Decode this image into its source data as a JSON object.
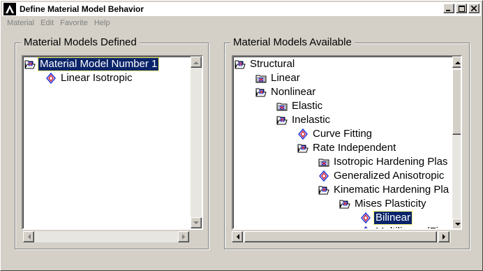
{
  "window": {
    "title": "Define Material Model Behavior"
  },
  "menu": [
    {
      "label": "Material"
    },
    {
      "label": "Edit"
    },
    {
      "label": "Favorite"
    },
    {
      "label": "Help"
    }
  ],
  "defined_panel": {
    "title": "Material Models Defined",
    "items": [
      {
        "label": "Material Model Number 1",
        "icon": "open-folder-icon",
        "selected": true
      },
      {
        "label": "Linear Isotropic",
        "icon": "diamond-leaf-icon",
        "selected": false
      }
    ]
  },
  "available_panel": {
    "title": "Material Models Available",
    "items": [
      {
        "label": "Structural",
        "icon": "open-folder-icon",
        "selected": false
      },
      {
        "label": "Linear",
        "icon": "closed-folder-icon",
        "selected": false
      },
      {
        "label": "Nonlinear",
        "icon": "open-folder-icon",
        "selected": false
      },
      {
        "label": "Elastic",
        "icon": "closed-folder-icon",
        "selected": false
      },
      {
        "label": "Inelastic",
        "icon": "open-folder-icon",
        "selected": false
      },
      {
        "label": "Curve Fitting",
        "icon": "diamond-leaf-icon",
        "selected": false
      },
      {
        "label": "Rate Independent",
        "icon": "open-folder-icon",
        "selected": false
      },
      {
        "label": "Isotropic Hardening Plas",
        "icon": "closed-folder-icon",
        "selected": false
      },
      {
        "label": "Generalized Anisotropic",
        "icon": "diamond-leaf-icon",
        "selected": false
      },
      {
        "label": "Kinematic Hardening Pla",
        "icon": "open-folder-icon",
        "selected": false
      },
      {
        "label": "Mises Plasticity",
        "icon": "open-folder-icon",
        "selected": false
      },
      {
        "label": "Bilinear",
        "icon": "diamond-leaf-icon",
        "selected": true
      },
      {
        "label": "Multilinear (Fi",
        "icon": "diamond-leaf-icon",
        "selected": false
      }
    ]
  },
  "colors": {
    "face": "#d4d0c8",
    "selection": "#0a246a",
    "leaf_red": "#d0102a",
    "leaf_blue": "#1a2ad0"
  }
}
